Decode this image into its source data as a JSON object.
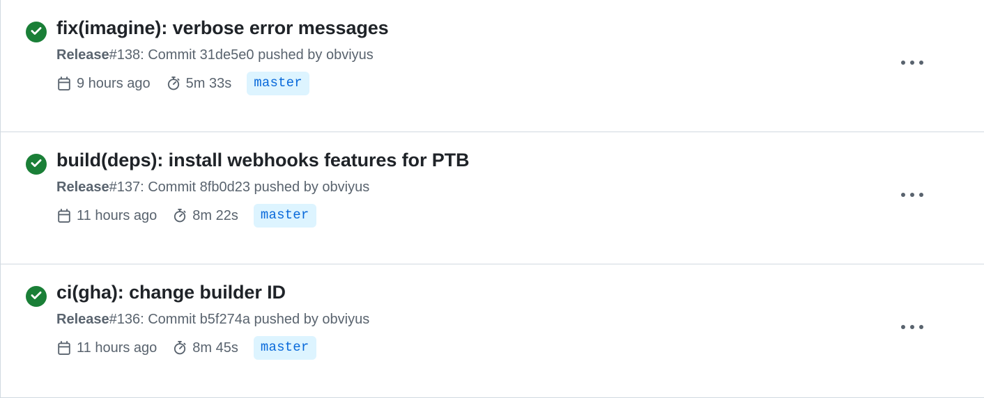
{
  "list": {
    "name": "workflow-runs-list",
    "divider_color": "#d1d9e0",
    "background": "#ffffff"
  },
  "icons": {
    "success": "check-circle-fill-icon",
    "calendar": "calendar-icon",
    "stopwatch": "stopwatch-icon",
    "kebab": "kebab-horizontal-icon"
  },
  "colors": {
    "success_green": "#1a7f37",
    "title_text": "#1f2328",
    "muted_text": "#59636e",
    "branch_badge_bg": "#ddf4ff",
    "branch_badge_text": "#0969da",
    "border": "#d1d9e0"
  },
  "runs": [
    {
      "status": "success",
      "title": "fix(imagine): verbose error messages",
      "meta_label": "Release",
      "meta_rest": "#138: Commit 31de5e0 pushed by obviyus",
      "release_number": "#138",
      "commit_sha": "31de5e0",
      "actor": "obviyus",
      "time_ago": "9 hours ago",
      "duration": "5m 33s",
      "branch": "master"
    },
    {
      "status": "success",
      "title": "build(deps): install webhooks features for PTB",
      "meta_label": "Release",
      "meta_rest": "#137: Commit 8fb0d23 pushed by obviyus",
      "release_number": "#137",
      "commit_sha": "8fb0d23",
      "actor": "obviyus",
      "time_ago": "11 hours ago",
      "duration": "8m 22s",
      "branch": "master"
    },
    {
      "status": "success",
      "title": "ci(gha): change builder ID",
      "meta_label": "Release",
      "meta_rest": "#136: Commit b5f274a pushed by obviyus",
      "release_number": "#136",
      "commit_sha": "b5f274a",
      "actor": "obviyus",
      "time_ago": "11 hours ago",
      "duration": "8m 45s",
      "branch": "master"
    }
  ]
}
